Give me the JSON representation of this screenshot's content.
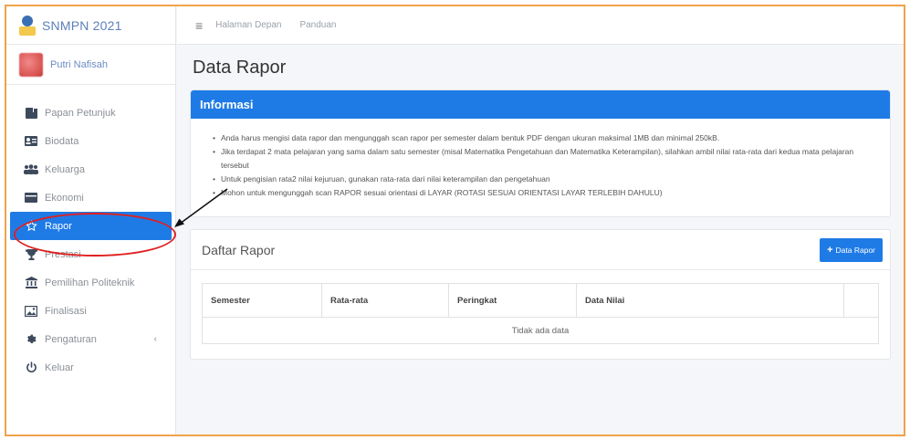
{
  "app": {
    "brand": "SNMPN 2021"
  },
  "user": {
    "name": "Putri Nafisah"
  },
  "sidebar": {
    "items": [
      {
        "label": "Papan Petunjuk",
        "icon": "dashboard-icon"
      },
      {
        "label": "Biodata",
        "icon": "id-card-icon"
      },
      {
        "label": "Keluarga",
        "icon": "users-icon"
      },
      {
        "label": "Ekonomi",
        "icon": "money-icon"
      },
      {
        "label": "Rapor",
        "icon": "star-icon",
        "active": true
      },
      {
        "label": "Prestasi",
        "icon": "trophy-icon"
      },
      {
        "label": "Pemilihan Politeknik",
        "icon": "institution-icon"
      },
      {
        "label": "Finalisasi",
        "icon": "image-icon"
      },
      {
        "label": "Pengaturan",
        "icon": "gear-icon",
        "chevron": "‹"
      },
      {
        "label": "Keluar",
        "icon": "power-icon"
      }
    ]
  },
  "topbar": {
    "menu_icon": "≡",
    "links": [
      "Halaman Depan",
      "Panduan"
    ]
  },
  "page": {
    "title": "Data Rapor"
  },
  "info": {
    "title": "Informasi",
    "items": [
      "Anda harus mengisi data rapor dan mengunggah scan rapor per semester dalam bentuk PDF dengan ukuran maksimal 1MB dan minimal 250kB.",
      "Jika terdapat 2 mata pelajaran yang sama dalam satu semester (misal Matematika Pengetahuan dan Matematika Keterampilan), silahkan ambil nilai rata-rata dari kedua mata pelajaran tersebut",
      "Untuk pengisian rata2 nilai kejuruan, gunakan rata-rata dari nilai keterampilan dan pengetahuan",
      "Mohon untuk mengunggah scan RAPOR sesuai orientasi di LAYAR (ROTASI SESUAI ORIENTASI LAYAR TERLEBIH DAHULU)"
    ]
  },
  "rapor": {
    "title": "Daftar Rapor",
    "add_button": "Data Rapor",
    "columns": [
      "Semester",
      "Rata-rata",
      "Peringkat",
      "Data Nilai",
      ""
    ],
    "empty_text": "Tidak ada data"
  },
  "colors": {
    "primary": "#1e7be6",
    "annotation": "#e02020",
    "frame": "#f0a24c"
  }
}
